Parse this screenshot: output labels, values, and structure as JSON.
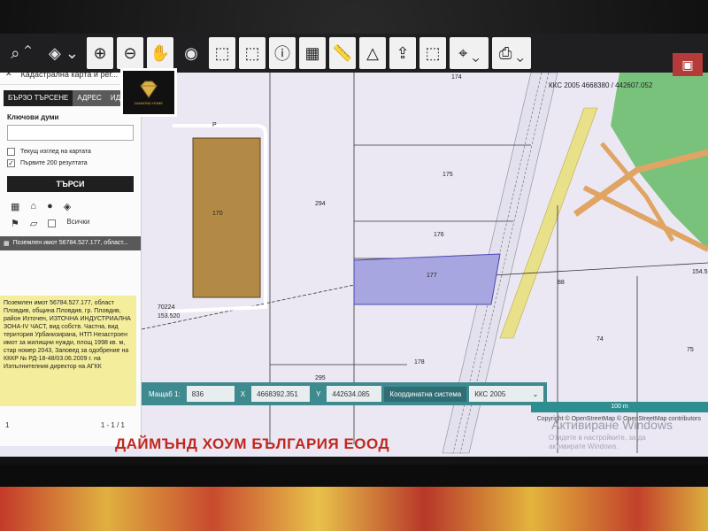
{
  "app": {
    "panel_title": "Кадастрална карта и рег...",
    "close": "✕"
  },
  "tabs": [
    {
      "label": "БЪРЗО ТЪРСЕНЕ"
    },
    {
      "label": "АДРЕС"
    },
    {
      "label": "ИДЕН"
    }
  ],
  "search": {
    "keywords_label": "Ключови думи",
    "keywords_value": "",
    "opt_current_view": "Текущ изглед на картата",
    "opt_first_200": "Първите 200 резултата",
    "button": "ТЪРСИ"
  },
  "filters": {
    "all_label": "Всички"
  },
  "results": {
    "header": "Поземлен имот 56784.527.177, област...",
    "info": "Поземлен имот 56784.527.177, област Пловдив, община Пловдив, гр. Пловдив, район Източен, ИЗТОЧНА ИНДУСТРИАЛНА ЗОНА-IV ЧАСТ, вид собств. Частна, вид територия Урбанизирана, НТП Незастроен имот за жилищни нужди, площ 1998 кв. м, стар номер 2043, Заповед за одобрение на КККР № РД-18-48/03.06.2009 г. на Изпълнителния директор на АГКК",
    "page": "1",
    "page_range": "1 - 1 / 1"
  },
  "map": {
    "parcels": [
      "174",
      "175",
      "176",
      "177",
      "178",
      "294",
      "295",
      "170",
      "88",
      "74",
      "75"
    ],
    "header_coord": "ККС 2005 4668380 / 442607.052",
    "point_labels": [
      "70224",
      "153.520",
      "154.5"
    ],
    "road_label": "Р",
    "scale_label": "100 m",
    "copyright": "Copyright © OpenStreetMap © OpenStreetMap contributors",
    "windows_title": "Активиране Windows",
    "windows_sub": "Отидете в настройките, за да активирате Windows."
  },
  "coordbar": {
    "scale_label": "Мащаб 1:",
    "scale_value": "836",
    "x_label": "X",
    "x_value": "4668392.351",
    "y_label": "Y",
    "y_value": "442634.085",
    "system_label": "Координатна система",
    "system_value": "ККС 2005"
  },
  "watermark": "ДАЙМЪНД ХОУМ БЪЛГАРИЯ ЕООД",
  "logo": {
    "text": "DIAMOND HOME"
  },
  "colors": {
    "selected_parcel": "#a7a6e0",
    "building": "#b38a45",
    "info_box": "#f4ee9c",
    "toolbar": "#1f1f21",
    "coordbar": "#3e8a8f",
    "watermark": "#c0281f"
  }
}
